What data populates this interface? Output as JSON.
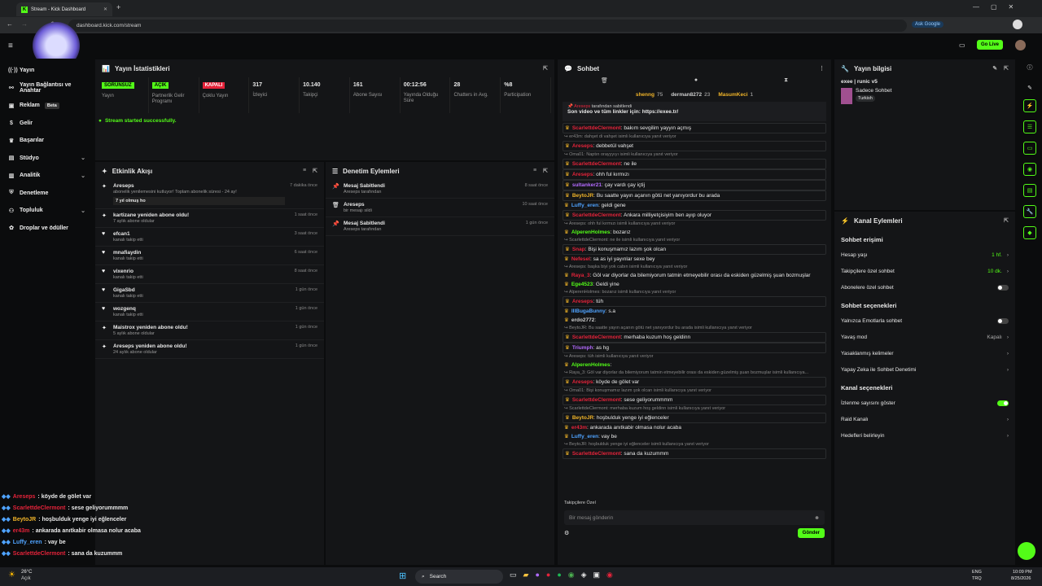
{
  "browser": {
    "tab_title": "Stream - Kick Dashboard",
    "url": "dashboard.kick.com/stream",
    "ask_google": "Ask Google"
  },
  "topbar": {
    "go_live": "Go Live"
  },
  "sidebar": {
    "items": [
      {
        "label": "Yayın",
        "icon": "stream-icon"
      },
      {
        "label": "Yayın Bağlantısı ve Anahtar",
        "icon": "link-icon"
      },
      {
        "label": "Reklam",
        "badge": "Beta",
        "icon": "ad-icon"
      },
      {
        "label": "Gelir",
        "icon": "money-icon"
      },
      {
        "label": "Başarılar",
        "icon": "trophy-icon"
      },
      {
        "label": "Stüdyo",
        "icon": "studio-icon",
        "chev": true
      },
      {
        "label": "Analitik",
        "icon": "chart-icon",
        "chev": true
      },
      {
        "label": "Denetleme",
        "icon": "shield-icon"
      },
      {
        "label": "Topluluk",
        "icon": "community-icon",
        "chev": true
      },
      {
        "label": "Droplar ve ödüller",
        "icon": "gift-icon"
      }
    ]
  },
  "stats_panel": {
    "title": "Yayın İstatistikleri",
    "status": "Stream started successfully.",
    "stats": [
      {
        "pill": "SORUNSUZ",
        "pill_color": "#53fc18",
        "label": "Yayın"
      },
      {
        "pill": "AÇIK",
        "pill_color": "#53fc18",
        "label": "Partnerlik Gelir Programı"
      },
      {
        "pill": "KAPALI",
        "pill_color": "#e5233a",
        "label": "Çoklu Yayın"
      },
      {
        "value": "317",
        "label": "İzleyici"
      },
      {
        "value": "10.140",
        "label": "Takipçi"
      },
      {
        "value": "161",
        "label": "Abone Sayısı"
      },
      {
        "value": "00:12:56",
        "label": "Yayında Olduğu Süre"
      },
      {
        "value": "28",
        "label": "Chatters in Avg."
      },
      {
        "value": "%8",
        "label": "Participation"
      }
    ]
  },
  "activity": {
    "title": "Etkinlik Akışı",
    "items": [
      {
        "name": "Areseps",
        "desc": "abonelik yenilemesini kutluyor! Toplam abonelik süresi - 24 ay!",
        "time": "7 dakika önce",
        "note": "7 yıl olmuş ho",
        "icon": "star-icon"
      },
      {
        "name": "kartizane yeniden abone oldu!",
        "desc": "7 aylık abone oldular",
        "time": "1 saat önce",
        "icon": "star-icon"
      },
      {
        "name": "efcan1",
        "desc": "kanalı takip etti",
        "time": "3 saat önce",
        "icon": "heart-icon"
      },
      {
        "name": "mnafiaydin",
        "desc": "kanalı takip etti",
        "time": "6 saat önce",
        "icon": "heart-icon"
      },
      {
        "name": "vixenrio",
        "desc": "kanalı takip etti",
        "time": "8 saat önce",
        "icon": "heart-icon"
      },
      {
        "name": "GigaSbd",
        "desc": "kanalı takip etti",
        "time": "1 gün önce",
        "icon": "heart-icon"
      },
      {
        "name": "wozgenq",
        "desc": "kanalı takip etti",
        "time": "1 gün önce",
        "icon": "heart-icon"
      },
      {
        "name": "Maistrox yeniden abone oldu!",
        "desc": "5 aylık abone oldular",
        "time": "1 gün önce",
        "icon": "star-icon"
      },
      {
        "name": "Areseps yeniden abone oldu!",
        "desc": "24 aylık abone oldular",
        "time": "1 gün önce",
        "icon": "star-icon"
      }
    ]
  },
  "moderation": {
    "title": "Denetim Eylemleri",
    "items": [
      {
        "name": "Mesaj Sabitlendi",
        "desc": "Areseps tarafından",
        "time": "8 saat önce",
        "icon": "pin-icon"
      },
      {
        "name": "Areseps",
        "desc": "bir mesajı sildi",
        "time": "10 saat önce",
        "icon": "trash-icon"
      },
      {
        "name": "Mesaj Sabitlendi",
        "desc": "Areseps tarafından",
        "time": "1 gün önce",
        "icon": "pin-icon"
      }
    ]
  },
  "chat": {
    "title": "Sohbet",
    "top": [
      {
        "name": "shenng",
        "n": "75",
        "color": "#f0b429"
      },
      {
        "name": "derman8272",
        "n": "23",
        "color": "#ccc"
      },
      {
        "name": "MasumKeci",
        "n": "1",
        "color": "#f0b429"
      }
    ],
    "pinned_by": "tarafından sabitlendi",
    "pinned_msg": "Son video ve tüm linkler için: https://exee.tr/",
    "lines": [
      {
        "u": "ScarlettdeClermont",
        "c": "#e5233a",
        "m": ": bakım sevgilim yayyın açmış",
        "box": true
      },
      {
        "reply": "er43m: dahşet di vahşet isimli kullanıcıya yanıt veriyor"
      },
      {
        "u": "Areseps",
        "c": "#e5233a",
        "m": ": debbetül vahşet",
        "box": true
      },
      {
        "reply": "Oma01: Naptın orayyyıyı isimli kullanıcıya yanıt veriyor"
      },
      {
        "u": "ScarlettdeClermont",
        "c": "#e5233a",
        "m": ": ne ile",
        "box": true
      },
      {
        "u": "Areseps",
        "c": "#e5233a",
        "m": ": ohh ful kırmızı",
        "box": true
      },
      {
        "u": "sultanker21",
        "c": "#b46bff",
        "m": ": çay vardı çay içtij",
        "box": true
      },
      {
        "u": "BeytoJR",
        "c": "#f0b429",
        "m": ": Bu saatte yayın açanın götü net yanıyordur bu arada",
        "box": true
      },
      {
        "u": "Luffy_eren",
        "c": "#4fa3ff",
        "m": ": geldi gene"
      },
      {
        "u": "ScarlettdeClermont",
        "c": "#e5233a",
        "m": ": Ankara milliyetçisiyim ben ayıp oluyor",
        "box": true
      },
      {
        "reply": "Areseps: ohh ful kırmızı isimli kullanıcıya yanıt veriyor"
      },
      {
        "u": "AlperenHolmes",
        "c": "#53fc18",
        "m": ": bozarız"
      },
      {
        "reply": "ScarlettdeClermont: ne ile isimli kullanıcıya yanıt veriyor"
      },
      {
        "u": "Snap",
        "c": "#e5233a",
        "m": ": Bişi konuşmamız lazım şok olcan",
        "box": true
      },
      {
        "u": "Nefesel",
        "c": "#e5233a",
        "m": ": sa as iyi yayınlar sexe bey"
      },
      {
        "reply": "Areseps: başka biyi yok cabın isimli kullanıcıya yanıt veriyor"
      },
      {
        "u": "Raya_3",
        "c": "#e5233a",
        "m": ": Göl var diyorlar da bilemiyorum tatmin etmeyebilir orası da eskiden güzelmiş şuan bozmuşlar"
      },
      {
        "u": "Ege4523",
        "c": "#53fc18",
        "m": ": Geldi yine"
      },
      {
        "reply": "AlperenHolmes: bozarız isimli kullanıcıya yanıt veriyor"
      },
      {
        "u": "Areseps",
        "c": "#e5233a",
        "m": ": tüh",
        "box": true
      },
      {
        "u": "IIlBugaBunny",
        "c": "#4fa3ff",
        "m": ": s.a"
      },
      {
        "u": "erdo2772",
        "c": "#ccc",
        "m": ":"
      },
      {
        "reply": "BeytoJR: Bu saatte yayın açanın götü net yanıyordur bu arada isimli kullanıcıya yanıt veriyor"
      },
      {
        "u": "ScarlettdeClermont",
        "c": "#e5233a",
        "m": ": merhaba kuzum hoş geldinn",
        "box": true
      },
      {
        "u": "Triumph",
        "c": "#b46bff",
        "m": ": as hg",
        "box": true
      },
      {
        "reply": "Areseps: tüh isimli kullanıcıya yanıt veriyor"
      },
      {
        "u": "AlperenHolmes",
        "c": "#53fc18",
        "m": ":"
      },
      {
        "reply": "Raya_3: Göl var diyorlar da bilemiyorum tatmin etmeyebilir orası da eskiden güzelmiş şuan bozmuşlar isimli kullanıcıya..."
      },
      {
        "u": "Areseps",
        "c": "#e5233a",
        "m": ": köyde de gölet var",
        "box": true
      },
      {
        "reply": "Oma01: Bişi konuşmamız lazım şok olcan isimli kullanıcıya yanıt veriyor"
      },
      {
        "u": "ScarlettdeClermont",
        "c": "#e5233a",
        "m": ": sese geliyorummmm",
        "box": true
      },
      {
        "reply": "ScarlettdeClermont: merhaba kuzum hoş geldinn isimli kullanıcıya yanıt veriyor"
      },
      {
        "u": "BeytoJR",
        "c": "#f0b429",
        "m": ": hoşbulduk yenge iyi eğlenceler",
        "box": true
      },
      {
        "u": "er43m",
        "c": "#e5233a",
        "m": ": ankarada anıtkabir olmasa nolur acaba"
      },
      {
        "u": "Luffy_eren",
        "c": "#4fa3ff",
        "m": ": vay be"
      },
      {
        "reply": "BeytoJR: hoşbulduk yenge iyi eğlenceler isimli kullanıcıya yanıt veriyor"
      },
      {
        "u": "ScarlettdeClermont",
        "c": "#e5233a",
        "m": ": sana da kuzummm",
        "box": true
      }
    ],
    "followers_only": "Takipçilere Özel",
    "input_placeholder": "Bir mesaj gönderin",
    "send": "Gönder"
  },
  "stream_info": {
    "title": "Yayın bilgisi",
    "stream_title": "exee | runic v5",
    "subtitle": "Sadece Sohbet",
    "lang": "Turkish"
  },
  "channel": {
    "title": "Kanal Eylemleri",
    "chat_access": {
      "title": "Sohbet erişimi",
      "rows": [
        {
          "label": "Hesap yaşı",
          "value": "1 hf.",
          "green": true
        },
        {
          "label": "Takipçilere özel sohbet",
          "value": "10 dk.",
          "green": true
        },
        {
          "label": "Abonelere özel sohbet",
          "toggle": false
        }
      ]
    },
    "chat_options": {
      "title": "Sohbet seçenekleri",
      "rows": [
        {
          "label": "Yalnızca Emotlarla sohbet",
          "toggle": false
        },
        {
          "label": "Yavaş mod",
          "value": "Kapalı"
        },
        {
          "label": "Yasaklanmış kelimeler",
          "value": ""
        },
        {
          "label": "Yapay Zeka ile Sohbet Denetimi",
          "value": ""
        }
      ]
    },
    "channel_options": {
      "title": "Kanal seçenekleri",
      "rows": [
        {
          "label": "İzlenme sayısını göster",
          "toggle": true
        },
        {
          "label": "Raid Kanalı",
          "value": ""
        },
        {
          "label": "Hedefleri belirleyin",
          "value": ""
        }
      ]
    }
  },
  "overlay": [
    {
      "u": "Areseps",
      "c": "#e5233a",
      "m": " : köyde de gölet var"
    },
    {
      "u": "ScarlettdeClermont",
      "c": "#e5233a",
      "m": " : sese geliyorummmm"
    },
    {
      "u": "BeytoJR",
      "c": "#f0b429",
      "m": " : hoşbulduk yenge iyi eğlenceler"
    },
    {
      "u": "er43m",
      "c": "#e5233a",
      "m": " : ankarada anıtkabir olmasa nolur acaba"
    },
    {
      "u": "Luffy_eren",
      "c": "#4fa3ff",
      "m": " : vay be"
    },
    {
      "u": "ScarlettdeClermont",
      "c": "#e5233a",
      "m": " : sana da kuzummm"
    }
  ],
  "taskbar": {
    "temp": "26°C",
    "weather": "Açık",
    "search": "Search",
    "lang1": "ENG",
    "lang2": "TRQ",
    "time": "10:09 PM",
    "date": "8/25/2026"
  }
}
